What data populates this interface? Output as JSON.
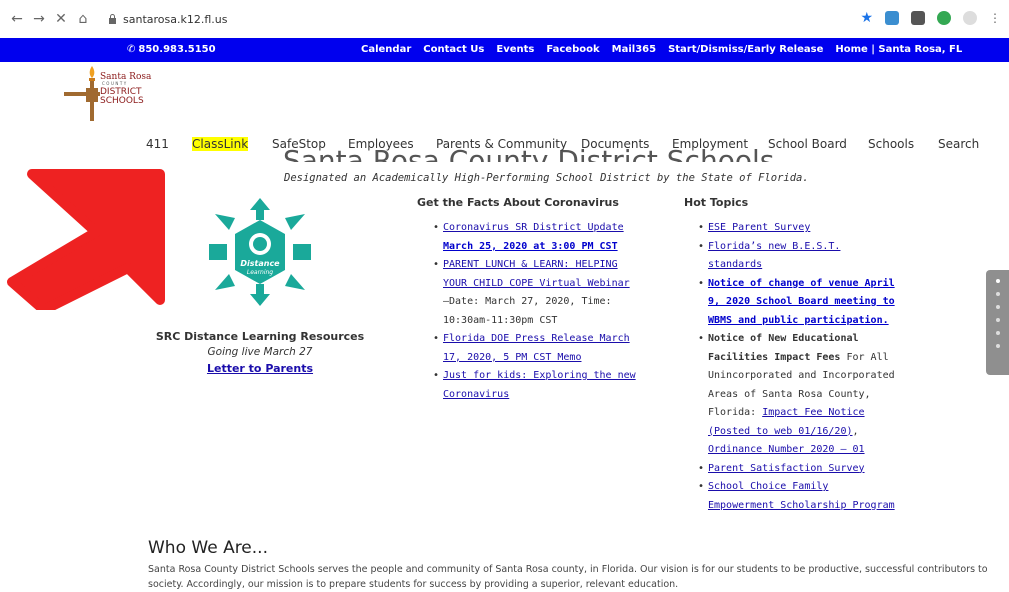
{
  "browser": {
    "url": "santarosa.k12.fl.us"
  },
  "topbar": {
    "phone": "850.983.5150",
    "links": [
      "Calendar",
      "Contact Us",
      "Events",
      "Facebook",
      "Mail365",
      "Start/Dismiss/Early Release",
      "Home | Santa Rosa, FL"
    ]
  },
  "logo": {
    "line1": "Santa Rosa",
    "line2": "COUNTY",
    "line3": "DISTRICT",
    "line4": "SCHOOLS"
  },
  "nav": [
    "411",
    "ClassLink",
    "SafeStop",
    "Employees",
    "Parents & Community",
    "Documents",
    "Employment",
    "School Board",
    "Schools",
    "Search"
  ],
  "hero": {
    "title": "Santa Rosa County District Schools",
    "tagline": "Designated an Academically High-Performing School District by the State of Florida."
  },
  "distance": {
    "icon_text_1": "Distance",
    "icon_text_2": "Learning",
    "title": "SRC Distance Learning Resources",
    "subtitle": "Going live March 27",
    "link": "Letter to Parents"
  },
  "facts": {
    "heading": "Get the Facts About Coronavirus",
    "items": [
      {
        "a": "Coronavirus SR District Update",
        "b": "March 25, 2020 at 3:00 PM CST"
      },
      {
        "a": "PARENT LUNCH & LEARN: HELPING YOUR CHILD COPE Virtual Webinar",
        "b": "–Date: March 27, 2020, Time: 10:30am-11:30pm CST"
      },
      {
        "a": "Florida DOE Press Release March 17, 2020, 5 PM CST Memo"
      },
      {
        "a": "Just for kids: Exploring the new Coronavirus"
      }
    ]
  },
  "hot": {
    "heading": "Hot Topics",
    "items": [
      {
        "a": "ESE Parent Survey"
      },
      {
        "a": "Florida’s new B.E.S.T. standards"
      },
      {
        "a": "Notice of change of venue April 9, 2020 School Board meeting to WBMS and public participation."
      },
      {
        "a": "Notice of New Educational Facilities Impact Fees",
        "b": " For All Unincorporated and Incorporated Areas of Santa Rosa County, Florida: ",
        "c": "Impact Fee Notice (Posted to web 01/16/20)",
        "d": ", ",
        "e": "Ordinance Number 2020 – 01"
      },
      {
        "a": "Parent Satisfaction Survey"
      },
      {
        "a": "School Choice Family Empowerment Scholarship Program"
      }
    ]
  },
  "who": {
    "heading": "Who We Are...",
    "text": "Santa Rosa County District Schools serves the people and community of Santa Rosa county, in Florida. Our vision is for our students to be productive, successful contributors to society. Accordingly, our mission is to prepare students for success by providing a superior, relevant education."
  },
  "colors": {
    "topbar_bg": "#0000ee",
    "link": "#1a0dab",
    "highlight": "#ffff00",
    "arrow": "#ee2222",
    "icon_teal": "#1aa99a"
  }
}
